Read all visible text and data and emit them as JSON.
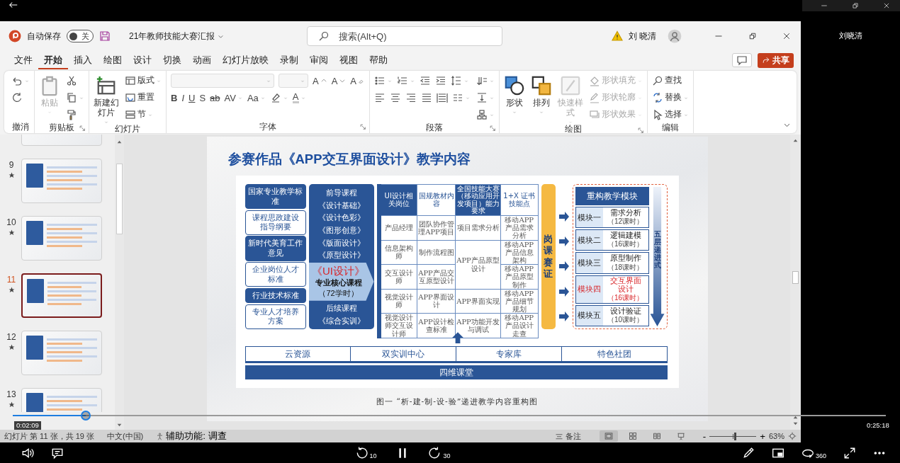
{
  "side_panel": {
    "user_name": "刘晓清"
  },
  "title_bar": {
    "autosave_label": "自动保存",
    "autosave_toggle": {
      "label": "关",
      "on": false
    },
    "document_title": "21年教师技能大赛汇报",
    "search": {
      "placeholder": "搜索(Alt+Q)"
    },
    "user_name": "刘 晓清"
  },
  "menu_tabs": [
    {
      "label": "文件",
      "selected": false
    },
    {
      "label": "开始",
      "selected": true
    },
    {
      "label": "插入",
      "selected": false
    },
    {
      "label": "绘图",
      "selected": false
    },
    {
      "label": "设计",
      "selected": false
    },
    {
      "label": "切换",
      "selected": false
    },
    {
      "label": "动画",
      "selected": false
    },
    {
      "label": "幻灯片放映",
      "selected": false
    },
    {
      "label": "录制",
      "selected": false
    },
    {
      "label": "审阅",
      "selected": false
    },
    {
      "label": "视图",
      "selected": false
    },
    {
      "label": "帮助",
      "selected": false
    }
  ],
  "share_button": "共享",
  "ribbon": {
    "groups": [
      {
        "label": "撤消",
        "launcher": false,
        "columns": [
          [
            {
              "kind": "undo",
              "caret": true
            },
            {
              "kind": "redo"
            }
          ]
        ]
      },
      {
        "label": "剪贴板",
        "launcher": true,
        "columns": [
          [
            {
              "kind": "paste",
              "label": "粘贴",
              "disabled": true,
              "caret": true
            }
          ],
          [
            {
              "kind": "cut"
            },
            {
              "kind": "copy",
              "caret": true
            },
            {
              "kind": "painter"
            }
          ]
        ]
      },
      {
        "label": "幻灯片",
        "launcher": false,
        "columns": [
          [
            {
              "kind": "new-slide",
              "label": "新建幻灯片",
              "caret": true
            }
          ],
          [
            {
              "kind": "layout",
              "label": "版式",
              "caret": true
            },
            {
              "kind": "reset",
              "label": "重置"
            },
            {
              "kind": "section",
              "label": "节",
              "caret": true
            }
          ]
        ]
      },
      {
        "label": "字体",
        "launcher": true,
        "columns": [
          [
            {
              "kind": "row",
              "items": [
                {
                  "kind": "font-name"
                },
                {
                  "kind": "font-size"
                },
                {
                  "kind": "grow",
                  "glyph": "A"
                },
                {
                  "kind": "shrink",
                  "glyph": "A"
                },
                {
                  "kind": "clear",
                  "glyph": "A"
                }
              ]
            },
            {
              "kind": "row",
              "items": [
                {
                  "kind": "bold",
                  "glyph": "B"
                },
                {
                  "kind": "italic",
                  "glyph": "I"
                },
                {
                  "kind": "underline",
                  "glyph": "U"
                },
                {
                  "kind": "shadow",
                  "glyph": "S"
                },
                {
                  "kind": "strike",
                  "glyph": "ab"
                },
                {
                  "kind": "spacing",
                  "glyph": "AV",
                  "caret": true
                },
                {
                  "kind": "case",
                  "glyph": "Aa",
                  "caret": true
                },
                {
                  "kind": "highlight",
                  "caret": true
                },
                {
                  "kind": "font-color",
                  "glyph": "A",
                  "caret": true
                }
              ]
            }
          ]
        ]
      },
      {
        "label": "段落",
        "launcher": true,
        "columns": [
          [
            {
              "kind": "row",
              "items": [
                {
                  "kind": "bullets",
                  "caret": true
                },
                {
                  "kind": "numbering",
                  "caret": true
                },
                {
                  "kind": "outdent"
                },
                {
                  "kind": "indent"
                },
                {
                  "kind": "line-spacing",
                  "caret": true
                }
              ]
            },
            {
              "kind": "row",
              "items": [
                {
                  "kind": "align-left"
                },
                {
                  "kind": "align-center"
                },
                {
                  "kind": "align-right"
                },
                {
                  "kind": "justify"
                },
                {
                  "kind": "distribute"
                },
                {
                  "kind": "columns",
                  "caret": true
                }
              ]
            }
          ],
          [
            {
              "kind": "direction",
              "caret": true
            },
            {
              "kind": "align-text",
              "caret": true
            },
            {
              "kind": "smartart",
              "caret": true
            }
          ]
        ]
      },
      {
        "label": "绘图",
        "launcher": true,
        "columns": [
          [
            {
              "kind": "shapes",
              "label": "形状",
              "caret": true
            }
          ],
          [
            {
              "kind": "arrange",
              "label": "排列",
              "caret": true
            }
          ],
          [
            {
              "kind": "styles",
              "label": "快速样式",
              "disabled": true,
              "caret": true
            }
          ],
          [
            {
              "kind": "fill",
              "label": "形状填充",
              "disabled": true,
              "caret": true
            },
            {
              "kind": "outline",
              "label": "形状轮廓",
              "disabled": true,
              "caret": true
            },
            {
              "kind": "effects",
              "label": "形状效果",
              "disabled": true,
              "caret": true
            }
          ]
        ]
      },
      {
        "label": "编辑",
        "launcher": false,
        "columns": [
          [
            {
              "kind": "find",
              "label": "查找"
            },
            {
              "kind": "replace",
              "label": "替换",
              "caret": true
            },
            {
              "kind": "select",
              "label": "选择",
              "caret": true
            }
          ]
        ]
      }
    ]
  },
  "thumbnails": [
    {
      "selected": false
    },
    {
      "number": "9",
      "selected": false
    },
    {
      "number": "10",
      "selected": false
    },
    {
      "number": "11",
      "selected": true
    },
    {
      "number": "12",
      "selected": false
    },
    {
      "number": "13",
      "selected": false
    }
  ],
  "slide": {
    "title": "参赛作品《APP交互界面设计》教学内容",
    "standards": [
      {
        "text": "国家专业教学标准",
        "filled": true
      },
      {
        "text": "课程思政建设指导纲要",
        "filled": false
      },
      {
        "text": "新时代美育工作意见",
        "filled": true
      },
      {
        "text": "企业岗位人才标准",
        "filled": false
      },
      {
        "text": "行业技术标准",
        "filled": true
      },
      {
        "text": "专业人才培养方案",
        "filled": false
      }
    ],
    "courses": {
      "pre_heading": "前导课程",
      "pre": [
        "《设计基础》",
        "《设计色彩》",
        "《图形创意》",
        "《版面设计》",
        "《原型设计》"
      ],
      "core": {
        "name": "《UI设计》",
        "label": "专业核心课程",
        "hours": "（72学时）"
      },
      "post_heading": "后续课程",
      "post": [
        "《综合实训》"
      ]
    },
    "table": {
      "columns": [
        {
          "text": "UI设计相关岗位",
          "filled": true
        },
        {
          "text": "国规教材内容",
          "filled": false
        },
        {
          "text": "全国技能大赛（移动应用开发项目）能力要求",
          "filled": true
        },
        {
          "text": "1+X 证书技能点",
          "filled": false
        }
      ],
      "rows": [
        {
          "cells": [
            {
              "text": "产品经理"
            },
            {
              "text": "团队协作管理APP项目"
            },
            {
              "text": "项目需求分析"
            },
            {
              "text": "移动APP产品需求分析"
            }
          ]
        },
        {
          "cells": [
            {
              "text": "信息架构师"
            },
            {
              "text": "制作流程图"
            },
            {
              "text": "APP产品原型设计",
              "rowspan": 2
            },
            {
              "text": "移动APP产品信息架构"
            }
          ]
        },
        {
          "cells": [
            {
              "text": "交互设计师"
            },
            {
              "text": "APP产品交互原型设计"
            },
            {
              "text": "移动APP产品原型制作"
            }
          ]
        },
        {
          "cells": [
            {
              "text": "视觉设计师"
            },
            {
              "text": "APP界面设计"
            },
            {
              "text": "APP界面实现"
            },
            {
              "text": "移动APP产品细节规划"
            }
          ]
        },
        {
          "cells": [
            {
              "text": "视觉设计师交互设计师"
            },
            {
              "text": "APP设计检查标准"
            },
            {
              "text": "APP功能开发与调试"
            },
            {
              "text": "移动APP产品设计走查"
            }
          ]
        }
      ]
    },
    "bridge": "岗课赛证",
    "modules": {
      "title": "重构教学模块",
      "items": [
        {
          "label": "模块一",
          "name": "需求分析",
          "hours": "（12课时）",
          "highlighted": false
        },
        {
          "label": "模块二",
          "name": "逻辑建模",
          "hours": "（16课时）",
          "highlighted": false
        },
        {
          "label": "模块三",
          "name": "原型制作",
          "hours": "（18课时）",
          "highlighted": false
        },
        {
          "label": "模块四",
          "name": "交互界面设计",
          "hours": "（16课时）",
          "highlighted": true
        },
        {
          "label": "模块五",
          "name": "设计验证",
          "hours": "（10课时）",
          "highlighted": false
        }
      ],
      "progression": "五层递进式"
    },
    "resources": [
      "云资源",
      "双实训中心",
      "专家库",
      "特色社团"
    ],
    "classroom": "四维课堂",
    "caption": "图一 “析-建-制-设-验”递进教学内容重构图"
  },
  "status_bar": {
    "slide_info": "幻灯片 第 11 张，共 19 张",
    "language": "中文(中国)",
    "accessibility": "辅助功能: 调查",
    "notes": "备注",
    "views": [
      {
        "kind": "normal",
        "selected": true
      },
      {
        "kind": "sorter",
        "selected": false
      },
      {
        "kind": "reading",
        "selected": false
      },
      {
        "kind": "slideshow",
        "selected": false
      }
    ],
    "zoom_out": "-",
    "zoom": {
      "level": 0.55
    },
    "zoom_in": "+",
    "zoom_value": "63%"
  },
  "video": {
    "progress": {
      "level": 0.084
    },
    "elapsed": "0:02:09",
    "duration": "0:25:18",
    "rewind": "10",
    "forward": "30",
    "vr": "360"
  }
}
